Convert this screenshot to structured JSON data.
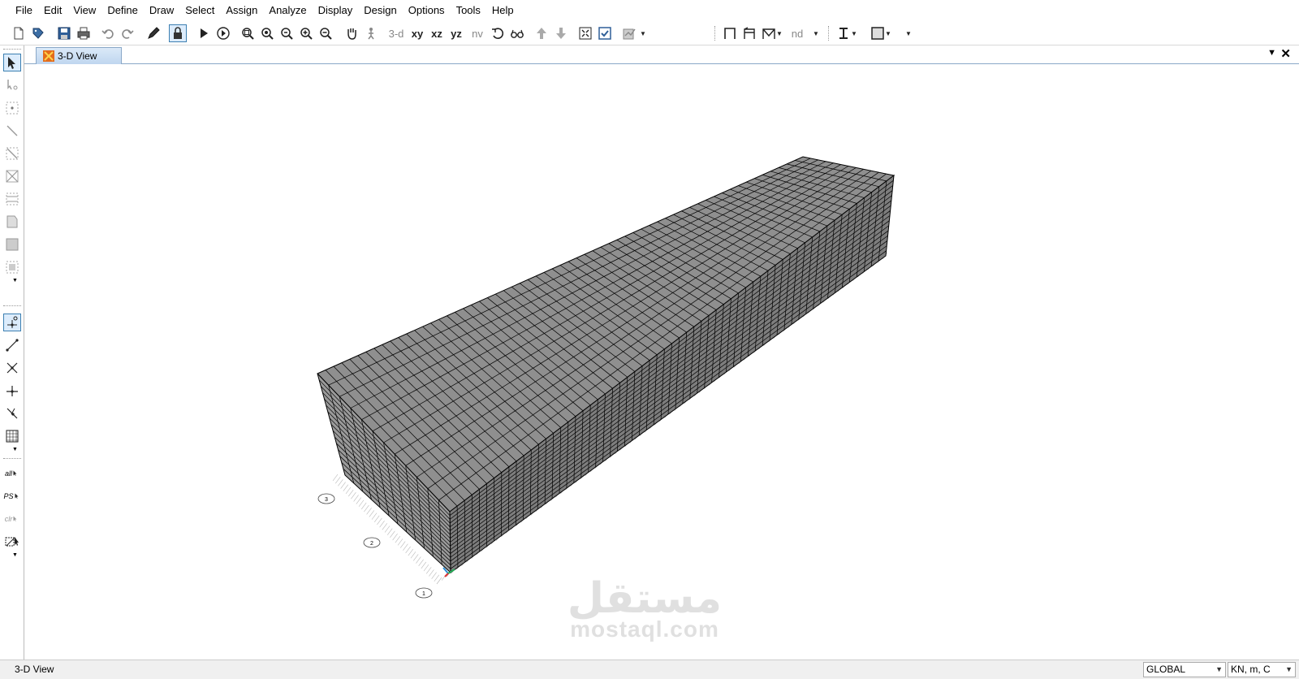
{
  "menu": [
    "File",
    "Edit",
    "View",
    "Define",
    "Draw",
    "Select",
    "Assign",
    "Analyze",
    "Display",
    "Design",
    "Options",
    "Tools",
    "Help"
  ],
  "toolbar": {
    "view_3d": "3-d",
    "view_xy": "xy",
    "view_xz": "xz",
    "view_yz": "yz",
    "view_nv": "nv",
    "display_nd": "nd"
  },
  "tab": {
    "label": "3-D View"
  },
  "sidebar": {
    "select_all": "all",
    "select_previous": "PS",
    "clear_selection": "clr"
  },
  "watermark": {
    "arabic": "مستقل",
    "latin": "mostaql.com"
  },
  "status": {
    "view_name": "3-D View",
    "coordinate_system": "GLOBAL",
    "units": "KN, m, C"
  },
  "grid_bubbles": [
    "1",
    "2",
    "3"
  ],
  "model": {
    "mesh_length_divisions": 60,
    "mesh_width_divisions": 12,
    "mesh_height_divisions": 16,
    "fill_color": "#9a9a9a",
    "top_color": "#8f8f8f",
    "side_color": "#7d7d7d",
    "line_color": "#000000"
  }
}
